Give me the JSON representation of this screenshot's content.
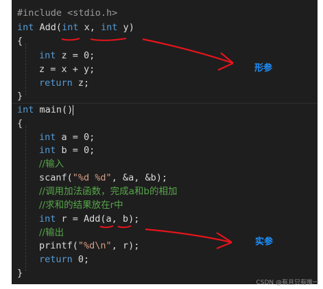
{
  "code": {
    "include": "#include <stdio.h>",
    "add_sig": {
      "kw_int": "int",
      "name": "Add",
      "open": "(",
      "p1_type": "int",
      "p1_name": "x",
      "comma": ",",
      "p2_type": "int",
      "p2_name": "y",
      "close": ")"
    },
    "brace_open_1": "{",
    "line_int_z": {
      "kw": "int",
      "rest": "z = 0;"
    },
    "line_z_assign": "z = x + y;",
    "line_return_z": {
      "kw": "return",
      "rest": "z;"
    },
    "brace_close_1": "}",
    "main_sig": {
      "kw_int": "int",
      "rest": "main()"
    },
    "brace_open_2": "{",
    "line_int_a": {
      "kw": "int",
      "rest": "a = 0;"
    },
    "line_int_b": {
      "kw": "int",
      "rest": "b = 0;"
    },
    "comment_input": "//输入",
    "line_scanf": {
      "fn": "scanf(",
      "str": "\"%d %d\"",
      "rest": ", &a, &b);"
    },
    "comment_call": "//调用加法函数，完成a和b的相加",
    "comment_store": "//求和的结果放在r中",
    "line_int_r": {
      "kw": "int",
      "rest": "r = Add(a, b);"
    },
    "comment_output": "//输出",
    "line_printf": {
      "fn": "printf(",
      "str": "\"%d\\n\"",
      "rest": ", r);"
    },
    "line_return_0": {
      "kw": "return",
      "rest": "0;"
    },
    "brace_close_2": "}"
  },
  "annotations": {
    "formal_params": "形参",
    "actual_params": "实参",
    "color": "#1e90ff",
    "mark_color": "#e8141b"
  },
  "watermark": "CSDN @有且只有唯一"
}
